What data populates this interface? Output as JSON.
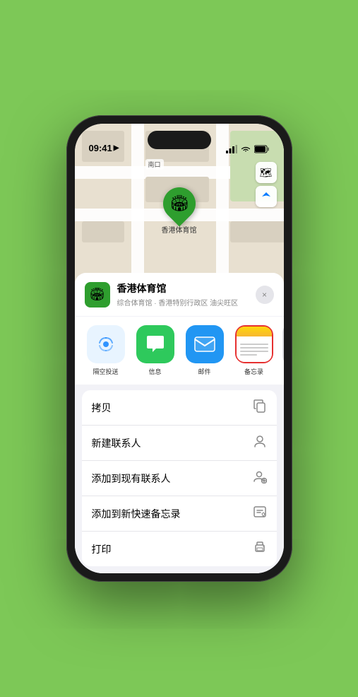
{
  "status": {
    "time": "09:41",
    "location_icon": "▶"
  },
  "map": {
    "label": "南口",
    "pin_label": "香港体育馆"
  },
  "map_buttons": [
    {
      "label": "🗺",
      "name": "map-type-button"
    },
    {
      "label": "⊕",
      "name": "location-button"
    }
  ],
  "venue": {
    "name": "香港体育馆",
    "subtitle": "综合体育馆 · 香港特别行政区 油尖旺区",
    "icon": "🏟",
    "close_label": "×"
  },
  "share_items": [
    {
      "id": "airdrop",
      "label": "隔空投送",
      "type": "airdrop"
    },
    {
      "id": "messages",
      "label": "信息",
      "type": "messages"
    },
    {
      "id": "mail",
      "label": "邮件",
      "type": "mail"
    },
    {
      "id": "notes",
      "label": "备忘录",
      "type": "notes"
    }
  ],
  "actions": [
    {
      "label": "拷贝",
      "icon": "⎘",
      "name": "copy-action"
    },
    {
      "label": "新建联系人",
      "icon": "👤",
      "name": "new-contact-action"
    },
    {
      "label": "添加到现有联系人",
      "icon": "👥",
      "name": "add-contact-action"
    },
    {
      "label": "添加到新快速备忘录",
      "icon": "⊡",
      "name": "add-notes-action"
    },
    {
      "label": "打印",
      "icon": "⎙",
      "name": "print-action"
    }
  ]
}
